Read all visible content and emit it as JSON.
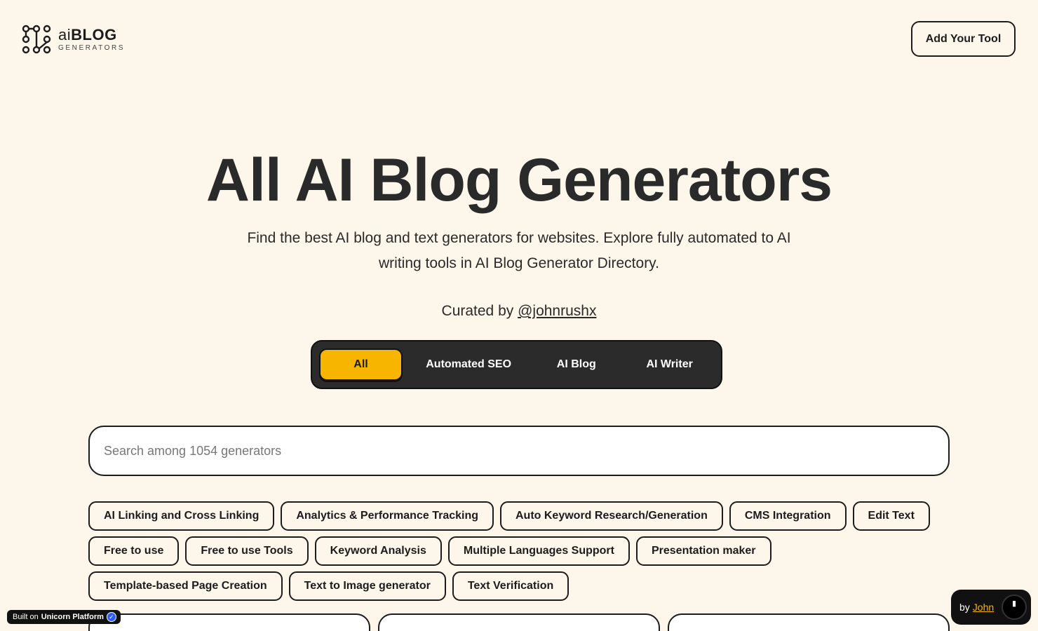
{
  "header": {
    "logo_ai": "ai",
    "logo_blog": "BLOG",
    "logo_sub": "GENERATORS",
    "add_tool_label": "Add Your Tool"
  },
  "hero": {
    "title": "All AI Blog Generators",
    "subtitle": "Find the best AI blog and text generators for websites. Explore fully automated to AI writing tools in AI Blog Generator Directory.",
    "curated_prefix": "Curated by ",
    "curated_handle": "@johnrushx"
  },
  "tabs": [
    {
      "label": "All",
      "active": true
    },
    {
      "label": "Automated SEO",
      "active": false
    },
    {
      "label": "AI Blog",
      "active": false
    },
    {
      "label": "AI Writer",
      "active": false
    }
  ],
  "search": {
    "placeholder": "Search among 1054 generators",
    "value": ""
  },
  "chips": [
    "AI Linking and Cross Linking",
    "Analytics & Performance Tracking",
    "Auto Keyword Research/Generation",
    "CMS Integration",
    "Edit Text",
    "Free to use",
    "Free to use Tools",
    "Keyword Analysis",
    "Multiple Languages Support",
    "Presentation maker",
    "Template-based Page Creation",
    "Text to Image generator",
    "Text Verification"
  ],
  "badges": {
    "built_prefix": "Built on ",
    "built_name": "Unicorn Platform",
    "by_prefix": "by",
    "by_name": "John"
  },
  "colors": {
    "background": "#fdf6ea",
    "accent": "#f7b500",
    "dark": "#2b2b2b"
  }
}
